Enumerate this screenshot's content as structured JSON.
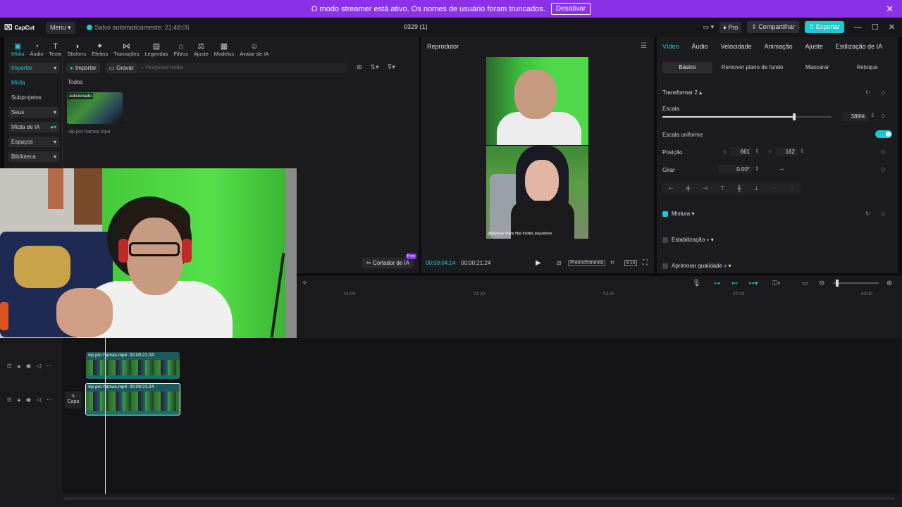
{
  "banner": {
    "message": "O modo streamer está ativo. Os nomes de usuário foram truncados.",
    "button": "Desativar"
  },
  "titlebar": {
    "app_logo": "CapCut",
    "menu": "Menu",
    "saved": "Salvo automaticamente: 21:48:05",
    "project": "0329 (1)",
    "pro": "Pro",
    "share": "Compartilhar",
    "export": "Exportar"
  },
  "toolbar": {
    "items": [
      {
        "label": "Mídia",
        "icon": "media-icon"
      },
      {
        "label": "Áudio",
        "icon": "audio-icon"
      },
      {
        "label": "Texto",
        "icon": "text-icon"
      },
      {
        "label": "Stickers",
        "icon": "sticker-icon"
      },
      {
        "label": "Efeitos",
        "icon": "effects-icon"
      },
      {
        "label": "Transições",
        "icon": "transitions-icon"
      },
      {
        "label": "Legendas",
        "icon": "captions-icon"
      },
      {
        "label": "Filtros",
        "icon": "filters-icon"
      },
      {
        "label": "Ajuste",
        "icon": "adjust-icon"
      },
      {
        "label": "Modelos",
        "icon": "templates-icon"
      },
      {
        "label": "Avatar de IA",
        "icon": "avatar-icon"
      }
    ]
  },
  "sidebar": {
    "items": [
      {
        "label": "Importar"
      },
      {
        "label": "Mídia"
      },
      {
        "label": "Subprojetos"
      },
      {
        "label": "Seus"
      },
      {
        "label": "Mídia de IA"
      },
      {
        "label": "Espaços"
      },
      {
        "label": "Biblioteca"
      }
    ]
  },
  "media": {
    "import": "Importar",
    "record": "Gravar",
    "search_placeholder": "Pesquisar mídia",
    "section": "Todos",
    "item_tag": "Adicionado",
    "item_name": "vip pro hamas.mp4",
    "cutter": "Cortador de IA",
    "cutter_badge": "Free"
  },
  "player": {
    "title": "Reprodutor",
    "current_time": "00:00:04:14",
    "duration": "00:00:21:24",
    "fill_label": "Preenchimento",
    "ratio": "9:16",
    "caption": "@lulyboys #clips #fyp #voltei_seguidores"
  },
  "props": {
    "tabs": [
      "Vídeo",
      "Áudio",
      "Velocidade",
      "Animação",
      "Ajuste",
      "Estilização de IA"
    ],
    "subtabs": [
      "Básico",
      "Remover plano de fundo",
      "Mascarar",
      "Retoque"
    ],
    "transform": "Transformar 2",
    "scale_label": "Escala",
    "scale_value": "389%",
    "scale_fraction": 0.78,
    "uniform_scale": "Escala uniforme",
    "position_label": "Posição",
    "pos_x_label": "X",
    "pos_x": "661",
    "pos_y_label": "Y",
    "pos_y": "162",
    "rotate_label": "Girar",
    "rotate_value": "0.00°",
    "blend": "Mistura",
    "stabilize": "Estabilização",
    "enhance": "Aprimorar qualidade"
  },
  "timeline": {
    "ruler": [
      "01:00",
      "01:30",
      "02:00",
      "02:30",
      "03:00"
    ],
    "clip1": {
      "name": "vip pro hamas.mp4",
      "duration": "00:00:21:24"
    },
    "clip2": {
      "name": "vip pro hamas.mp4",
      "duration": "00:00:21:24"
    },
    "cover": "Capa"
  },
  "colors": {
    "accent": "#1fc8d0",
    "banner": "#8b32e8"
  }
}
